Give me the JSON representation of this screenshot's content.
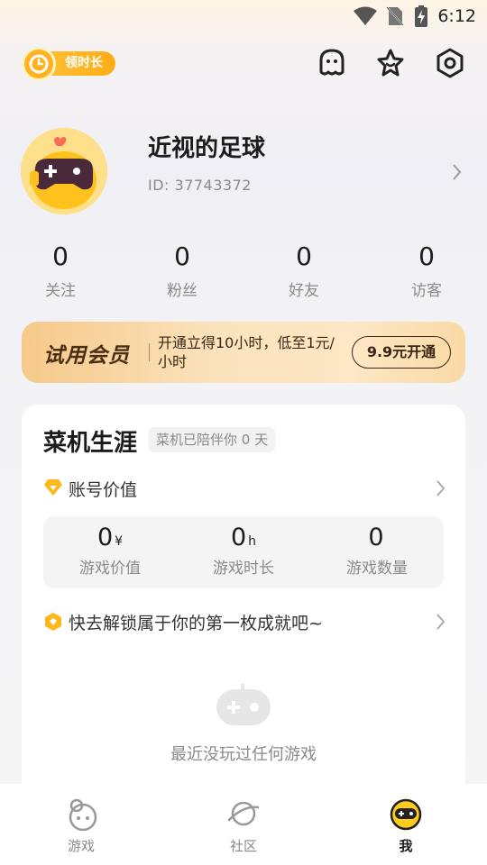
{
  "status_bar": {
    "time": "6:12",
    "icons": [
      "wifi-icon",
      "no-sim-icon",
      "battery-charging-icon"
    ]
  },
  "header": {
    "claim_label": "领时长",
    "icons": [
      "message-icon",
      "star-icon",
      "settings-icon"
    ]
  },
  "profile": {
    "nickname": "近视的足球",
    "id_text": "ID: 37743372"
  },
  "stats": [
    {
      "value": "0",
      "label": "关注"
    },
    {
      "value": "0",
      "label": "粉丝"
    },
    {
      "value": "0",
      "label": "好友"
    },
    {
      "value": "0",
      "label": "访客"
    }
  ],
  "vip": {
    "title": "试用会员",
    "description": "开通立得10小时，低至1元/小时",
    "button": "9.9元开通"
  },
  "career": {
    "title": "菜机生涯",
    "tag": "菜机已陪伴你 0 天",
    "account_value_label": "账号价值",
    "values": [
      {
        "value": "0",
        "unit": "¥",
        "label": "游戏价值"
      },
      {
        "value": "0",
        "unit": "h",
        "label": "游戏时长"
      },
      {
        "value": "0",
        "unit": "",
        "label": "游戏数量"
      }
    ],
    "achievement_text": "快去解锁属于你的第一枚成就吧~",
    "empty_text": "最近没玩过任何游戏"
  },
  "tabbar": [
    {
      "label": "游戏",
      "icon": "planet-game-icon",
      "active": false
    },
    {
      "label": "社区",
      "icon": "planet-icon",
      "active": false
    },
    {
      "label": "我",
      "icon": "mascot-face-icon",
      "active": true
    }
  ]
}
